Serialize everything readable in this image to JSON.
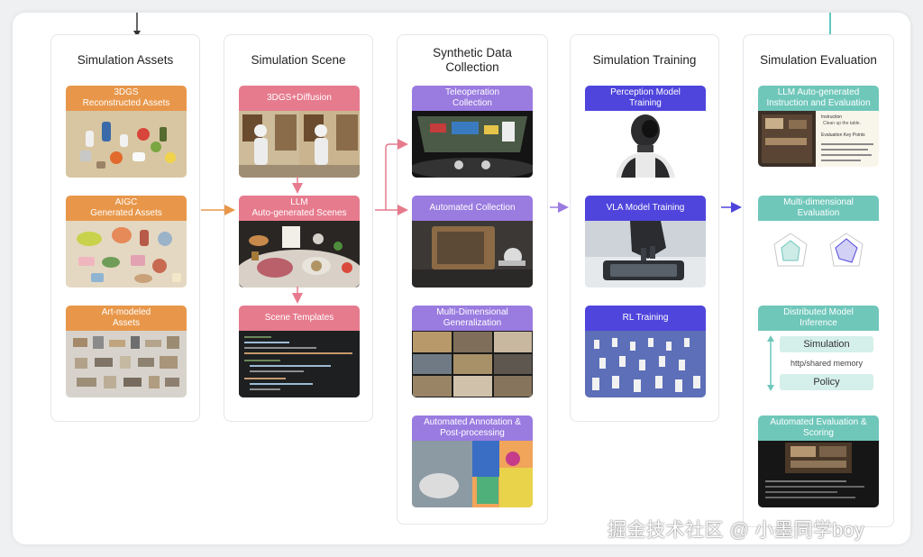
{
  "columns": [
    {
      "title": "Simulation Assets",
      "cards": [
        {
          "line1": "3DGS",
          "line2": "Reconstructed Assets"
        },
        {
          "line1": "AIGC",
          "line2": "Generated Assets"
        },
        {
          "line1": "Art-modeled",
          "line2": "Assets"
        }
      ]
    },
    {
      "title": "Simulation Scene",
      "cards": [
        {
          "line1": "3DGS+Diffusion",
          "line2": ""
        },
        {
          "line1": "LLM",
          "line2": "Auto-generated Scenes"
        },
        {
          "line1": "Scene Templates",
          "line2": ""
        }
      ]
    },
    {
      "title_line1": "Synthetic Data",
      "title_line2": "Collection",
      "cards": [
        {
          "line1": "Teleoperation",
          "line2": "Collection"
        },
        {
          "line1": "Automated Collection",
          "line2": ""
        },
        {
          "line1": "Multi-Dimensional",
          "line2": "Generalization"
        },
        {
          "line1": "Automated Annotation &",
          "line2": "Post-processing"
        }
      ]
    },
    {
      "title": "Simulation Training",
      "cards": [
        {
          "line1": "Perception Model",
          "line2": "Training"
        },
        {
          "line1": "VLA Model Training",
          "line2": ""
        },
        {
          "line1": "RL Training",
          "line2": ""
        }
      ]
    },
    {
      "title": "Simulation Evaluation",
      "cards": [
        {
          "line1": "LLM Auto-generated",
          "line2": "Instruction and Evaluation"
        },
        {
          "line1": "Multi-dimensional",
          "line2": "Evaluation"
        },
        {
          "line1": "Distributed Model",
          "line2": "Inference"
        },
        {
          "line1": "Automated Evaluation &",
          "line2": "Scoring"
        }
      ]
    }
  ],
  "inference": {
    "sim": "Simulation",
    "mid": "http/shared memory",
    "policy": "Policy"
  },
  "eval_doc": {
    "head": "Instruction",
    "sub": "Clean up the table.",
    "kp": "Evaluation Key Points"
  },
  "watermark": "掘金技术社区 @ 小墨同学boy",
  "colors": {
    "orange": "#e8974a",
    "pink": "#e77b8e",
    "purple": "#9a7be0",
    "blue": "#4f45dc",
    "teal": "#6fc7ba"
  }
}
